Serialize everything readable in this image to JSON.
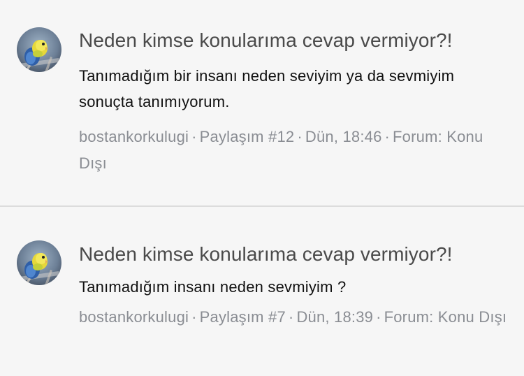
{
  "posts": [
    {
      "avatar_icon": "budgie-avatar-icon",
      "title": "Neden kimse konularıma cevap vermiyor?!",
      "body": "Tanımadığım bir insanı neden seviyim ya da sevmiyim sonuçta tanımıyorum.",
      "author": "bostankorkulugi",
      "post_number": "Paylaşım #12",
      "time": "Dün, 18:46",
      "forum_label": "Forum:",
      "forum_name": "Konu Dışı"
    },
    {
      "avatar_icon": "budgie-avatar-icon",
      "title": "Neden kimse konularıma cevap vermiyor?!",
      "body": "Tanımadığım insanı neden sevmiyim ?",
      "author": "bostankorkulugi",
      "post_number": "Paylaşım #7",
      "time": "Dün, 18:39",
      "forum_label": "Forum:",
      "forum_name": "Konu Dışı"
    }
  ],
  "separator": "·",
  "colors": {
    "background": "#f6f6f6",
    "title": "#4a4a4a",
    "body": "#111111",
    "meta": "#8a8d93",
    "divider": "#dcdcdc"
  }
}
